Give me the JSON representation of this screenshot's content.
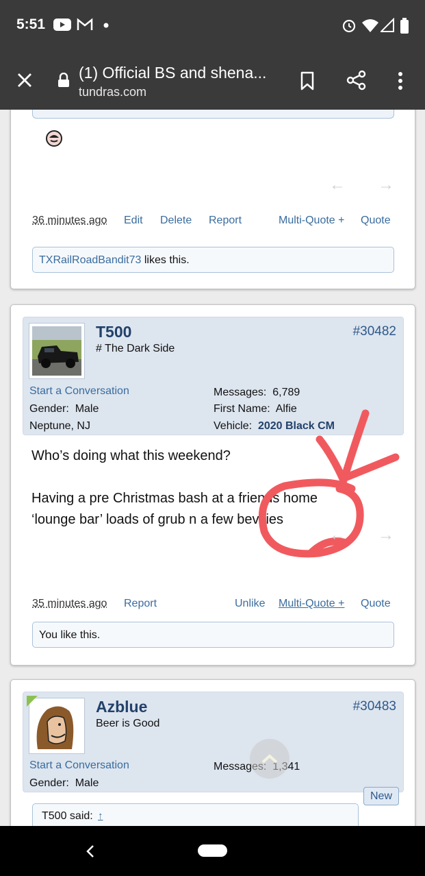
{
  "status": {
    "time": "5:51"
  },
  "toolbar": {
    "title": "(1) Official BS and shena...",
    "url": "tundras.com"
  },
  "post1": {
    "timestamp": "36 minutes ago",
    "actions": {
      "edit": "Edit",
      "delete": "Delete",
      "report": "Report",
      "multiquote": "Multi-Quote +",
      "quote": "Quote"
    },
    "likes_user": "TXRailRoadBandit73",
    "likes_suffix": " likes this."
  },
  "post2": {
    "username": "T500",
    "user_title": "# The Dark Side",
    "post_number": "#30482",
    "start_conversation": "Start a Conversation",
    "gender_label": "Gender:",
    "gender": "Male",
    "location": "Neptune, NJ",
    "messages_label": "Messages:",
    "messages": "6,789",
    "first_name_label": "First Name:",
    "first_name": "Alfie",
    "vehicle_label": "Vehicle:",
    "vehicle": "2020 Black CM",
    "message_line1": "Who’s doing what this weekend?",
    "message_line2": "Having a pre Christmas bash at a friends home",
    "message_line3": "‘lounge bar’ loads of grub n a few bevvies",
    "timestamp": "35 minutes ago",
    "actions": {
      "report": "Report",
      "unlike": "Unlike",
      "multiquote": "Multi-Quote +",
      "quote": "Quote"
    },
    "likes_text": "You like this."
  },
  "post3": {
    "username": "Azblue",
    "user_title": "Beer is Good",
    "post_number": "#30483",
    "start_conversation": "Start a Conversation",
    "gender_label": "Gender:",
    "gender": "Male",
    "messages_label": "Messages:",
    "messages": "1,341",
    "new_badge": "New",
    "quote_author": "T500 said:",
    "quote_link": "↑"
  },
  "colors": {
    "annotation": "#f05a5e",
    "link": "#3a6c9e",
    "header_bg": "#3a3a3a"
  }
}
